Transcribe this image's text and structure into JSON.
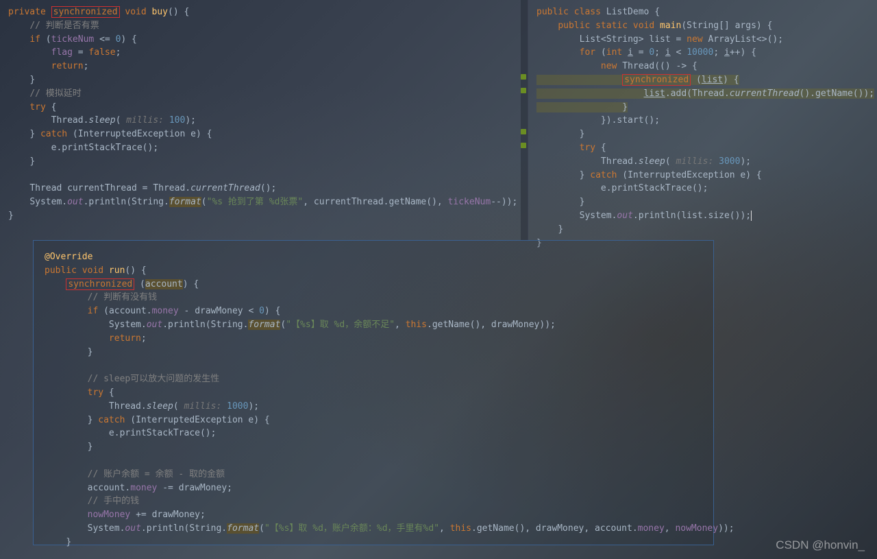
{
  "panelLeftTop": {
    "l0": {
      "kw_private": "private",
      "kw_sync": "synchronized",
      "kw_void": "void",
      "name": "buy",
      "p1": "() {"
    },
    "l1": "// 判断是否有票",
    "l2": {
      "kw_if": "if",
      "open": " (",
      "field": "tickeNum",
      "op": " <= ",
      "num": "0",
      "close": ") {"
    },
    "l3": {
      "field": "flag",
      "op": " = ",
      "kw": "false",
      "end": ";"
    },
    "l4": {
      "kw": "return",
      "end": ";"
    },
    "l5": "}",
    "l6": "// 模拟延时",
    "l7": {
      "kw": "try",
      "open": " {"
    },
    "l8": {
      "cls": "Thread.",
      "m": "sleep",
      "open": "( ",
      "param": "millis: ",
      "num": "100",
      "close": ");"
    },
    "l9": {
      "close": "} ",
      "kw": "catch",
      "open": " (InterruptedException e) {"
    },
    "l10": "e.printStackTrace();",
    "l11": "}",
    "l12": {
      "cls": "Thread currentThread = Thread.",
      "m": "currentThread",
      "end": "();"
    },
    "l13": {
      "cls": "System.",
      "f": "out",
      "dot": ".println(String.",
      "m": "format",
      "open": "(",
      "str": "\"%s 抢到了第 %d张票\"",
      "mid": ", currentThread.getName(), ",
      "field": "tickeNum",
      "end": "--));"
    },
    "l14": "}"
  },
  "panelRight": {
    "l0": {
      "kw1": "public class ",
      "name": "ListDemo",
      "open": " {"
    },
    "l1": {
      "kw": "public static void ",
      "m": "main",
      "open": "(String[] args) {"
    },
    "l2": {
      "t": "List<String> list = ",
      "kw": "new ",
      "c": "ArrayList<>();"
    },
    "l3": {
      "kw": "for ",
      "open": "(",
      "kw2": "int ",
      "v": "i",
      "eq": " = ",
      "n0": "0",
      "sep": "; ",
      "v2": "i",
      "lt": " < ",
      "n1": "10000",
      "sep2": "; ",
      "v3": "i",
      "inc": "++) {"
    },
    "l4": {
      "kw": "new ",
      "c": "Thread(() -> {"
    },
    "l5": {
      "kw": "synchronized",
      "open": " (",
      "u": "list",
      "close": ") {"
    },
    "l6": {
      "u": "list",
      "dot": ".add(Thread.",
      "m": "currentThread",
      "dot2": "().getName());"
    },
    "l7": "}",
    "l8": "}).start();",
    "l9": "}",
    "l10": {
      "kw": "try",
      "open": " {"
    },
    "l11": {
      "cls": "Thread.",
      "m": "sleep",
      "open": "( ",
      "param": "millis: ",
      "num": "3000",
      "close": ");"
    },
    "l12": {
      "close": "} ",
      "kw": "catch",
      "open": " (InterruptedException e) {"
    },
    "l13": "e.printStackTrace();",
    "l14": "}",
    "l15": {
      "cls": "System.",
      "f": "out",
      "dot": ".println(list.size());"
    },
    "l16": "}",
    "l17": "}"
  },
  "panelBottom": {
    "l0": {
      "ann": "@Override"
    },
    "l1": {
      "kw": "public void ",
      "m": "run",
      "open": "() {"
    },
    "l2": {
      "kw": "synchronized",
      "open": " (",
      "v": "account",
      "close": ") {"
    },
    "l3": "// 判断有没有钱",
    "l4": {
      "kw": "if ",
      "open": "(",
      "v": "account",
      "dot": ".",
      "f": "money",
      "op": " - ",
      "v2": "drawMoney",
      "cmp": " < ",
      "n": "0",
      "close": ") {"
    },
    "l5": {
      "cls": "System.",
      "f": "out",
      "dot": ".println(String.",
      "m": "format",
      "open": "(",
      "str": "\"【%s】取 %d，余额不足\"",
      "mid": ", ",
      "kw": "this",
      "d": ".getName(), ",
      "v": "drawMoney",
      "close": "));"
    },
    "l6": {
      "kw": "return",
      "end": ";"
    },
    "l7": "}",
    "l8": "// sleep可以放大问题的发生性",
    "l9": {
      "kw": "try",
      "open": " {"
    },
    "l10": {
      "cls": "Thread.",
      "m": "sleep",
      "open": "( ",
      "param": "millis: ",
      "num": "1000",
      "close": ");"
    },
    "l11": {
      "close": "} ",
      "kw": "catch",
      "open": " (InterruptedException e) {"
    },
    "l12": "e.printStackTrace();",
    "l13": "}",
    "l14": "// 账户余额 = 余额 - 取的金额",
    "l15": {
      "v": "account",
      "dot": ".",
      "f": "money",
      "op": " -= ",
      "v2": "drawMoney",
      "end": ";"
    },
    "l16": "// 手中的钱",
    "l17": {
      "f": "nowMoney",
      "op": " += ",
      "v": "drawMoney",
      "end": ";"
    },
    "l18": {
      "cls": "System.",
      "f": "out",
      "dot": ".println(String.",
      "m": "format",
      "open": "(",
      "str": "\"【%s】取 %d，账户余额：%d，手里有%d\"",
      "mid": ", ",
      "kw": "this",
      "d": ".getName(), ",
      "v1": "drawMoney",
      "c1": ", ",
      "v2": "account",
      "dot2": ".",
      "f2": "money",
      "c2": ", ",
      "f3": "nowMoney",
      "close": "));"
    },
    "l19": "}"
  },
  "watermark": "CSDN @honvin_"
}
